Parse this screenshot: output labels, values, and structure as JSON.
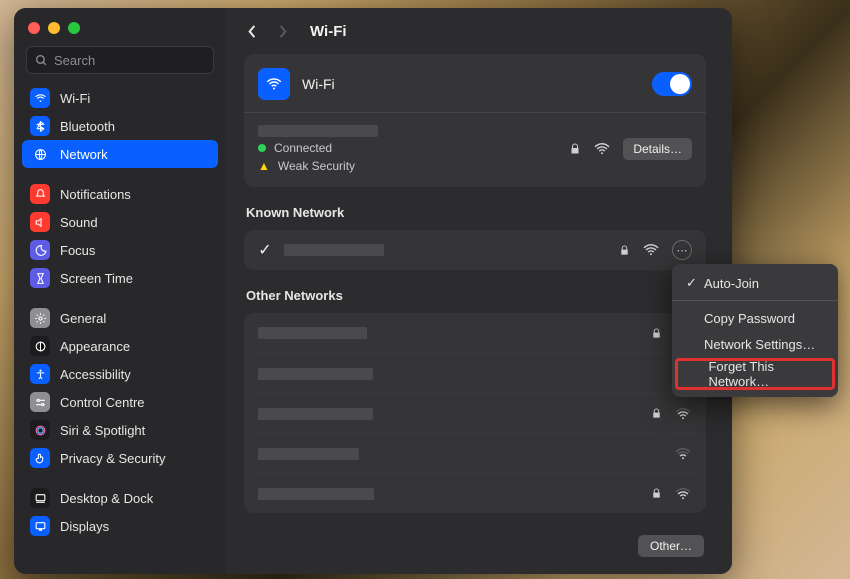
{
  "window": {
    "title": "Wi-Fi"
  },
  "search": {
    "placeholder": "Search"
  },
  "sidebar": {
    "items": [
      {
        "label": "Wi-Fi",
        "icon": "wifi",
        "bg": "#0a60ff",
        "selected": false
      },
      {
        "label": "Bluetooth",
        "icon": "bt",
        "bg": "#0a60ff",
        "selected": false
      },
      {
        "label": "Network",
        "icon": "globe",
        "bg": "#0a60ff",
        "selected": true
      },
      {
        "label": "Notifications",
        "icon": "bell",
        "bg": "#ff3b30",
        "selected": false
      },
      {
        "label": "Sound",
        "icon": "speaker",
        "bg": "#ff3b30",
        "selected": false
      },
      {
        "label": "Focus",
        "icon": "moon",
        "bg": "#5e5ce6",
        "selected": false
      },
      {
        "label": "Screen Time",
        "icon": "hour",
        "bg": "#5e5ce6",
        "selected": false
      },
      {
        "label": "General",
        "icon": "gear",
        "bg": "#8e8e93",
        "selected": false
      },
      {
        "label": "Appearance",
        "icon": "appear",
        "bg": "#1c1c1e",
        "selected": false
      },
      {
        "label": "Accessibility",
        "icon": "access",
        "bg": "#0a60ff",
        "selected": false
      },
      {
        "label": "Control Centre",
        "icon": "control",
        "bg": "#8e8e93",
        "selected": false
      },
      {
        "label": "Siri & Spotlight",
        "icon": "siri",
        "bg": "#1c1c1e",
        "selected": false
      },
      {
        "label": "Privacy & Security",
        "icon": "hand",
        "bg": "#0a60ff",
        "selected": false
      },
      {
        "label": "Desktop & Dock",
        "icon": "dock",
        "bg": "#1c1c1e",
        "selected": false
      },
      {
        "label": "Displays",
        "icon": "display",
        "bg": "#0a60ff",
        "selected": false
      }
    ],
    "group_breaks_after": [
      2,
      6,
      12
    ]
  },
  "wifi_card": {
    "title": "Wi-Fi",
    "toggle_on": true,
    "details_label": "Details…",
    "status_connected": "Connected",
    "status_warning": "Weak Security"
  },
  "sections": {
    "known": "Known Network",
    "other": "Other Networks",
    "other_button": "Other…"
  },
  "known_networks": [
    {
      "checked": true,
      "locked": true,
      "strength": 3,
      "has_more": true
    }
  ],
  "other_networks": [
    {
      "locked": true,
      "strength": 2
    },
    {
      "locked": false,
      "strength": 3
    },
    {
      "locked": true,
      "strength": 2
    },
    {
      "locked": false,
      "strength": 1
    },
    {
      "locked": true,
      "strength": 2
    }
  ],
  "context_menu": {
    "items": [
      {
        "label": "Auto-Join",
        "checked": true,
        "highlighted": false
      },
      {
        "label": "Copy Password",
        "checked": false,
        "highlighted": false
      },
      {
        "label": "Network Settings…",
        "checked": false,
        "highlighted": false
      },
      {
        "label": "Forget This Network…",
        "checked": false,
        "highlighted": true
      }
    ]
  }
}
